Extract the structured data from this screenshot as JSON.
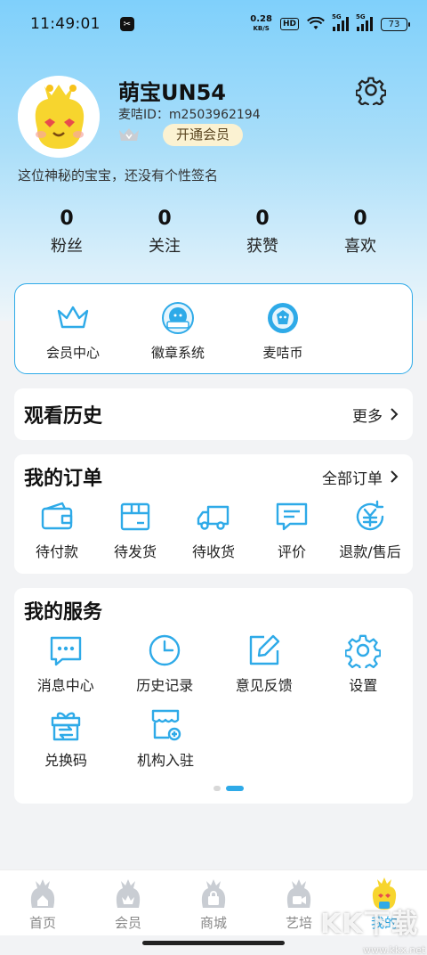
{
  "status_bar": {
    "time": "11:49:01",
    "net_speed_value": "0.28",
    "net_speed_unit": "KB/S",
    "hd_badge": "HD",
    "signal_tag": "5G",
    "battery": "73"
  },
  "profile": {
    "username": "萌宝UN54",
    "user_id": "麦咭ID：m2503962194",
    "vip_button": "开通会员",
    "signature": "这位神秘的宝宝，还没有个性签名"
  },
  "stats": [
    {
      "value": "0",
      "label": "粉丝"
    },
    {
      "value": "0",
      "label": "关注"
    },
    {
      "value": "0",
      "label": "获赞"
    },
    {
      "value": "0",
      "label": "喜欢"
    }
  ],
  "quick_entries": [
    {
      "label": "会员中心",
      "icon": "crown-icon"
    },
    {
      "label": "徽章系统",
      "icon": "badge-icon"
    },
    {
      "label": "麦咭币",
      "icon": "coin-icon"
    }
  ],
  "history": {
    "title": "观看历史",
    "more": "更多"
  },
  "orders": {
    "title": "我的订单",
    "more": "全部订单",
    "items": [
      {
        "label": "待付款",
        "icon": "wallet-icon"
      },
      {
        "label": "待发货",
        "icon": "package-icon"
      },
      {
        "label": "待收货",
        "icon": "truck-icon"
      },
      {
        "label": "评价",
        "icon": "comment-icon"
      },
      {
        "label": "退款/售后",
        "icon": "refund-icon"
      }
    ]
  },
  "services": {
    "title": "我的服务",
    "items": [
      {
        "label": "消息中心",
        "icon": "message-icon"
      },
      {
        "label": "历史记录",
        "icon": "clock-icon"
      },
      {
        "label": "意见反馈",
        "icon": "edit-icon"
      },
      {
        "label": "设置",
        "icon": "gear-icon"
      },
      {
        "label": "兑换码",
        "icon": "gift-icon"
      },
      {
        "label": "机构入驻",
        "icon": "store-icon"
      }
    ],
    "pager_active": 2,
    "pager_total": 2
  },
  "tabs": [
    {
      "label": "首页",
      "icon": "home-icon"
    },
    {
      "label": "会员",
      "icon": "vip-icon"
    },
    {
      "label": "商城",
      "icon": "shop-icon"
    },
    {
      "label": "艺培",
      "icon": "training-icon"
    },
    {
      "label": "我的",
      "icon": "mascot-icon",
      "active": true
    }
  ],
  "watermark": {
    "text": "KK下载",
    "url": "www.kkx.net"
  },
  "colors": {
    "accent": "#2eaae8",
    "vip_bg": "#fbf2d2",
    "header_top": "#7fd0fb"
  }
}
